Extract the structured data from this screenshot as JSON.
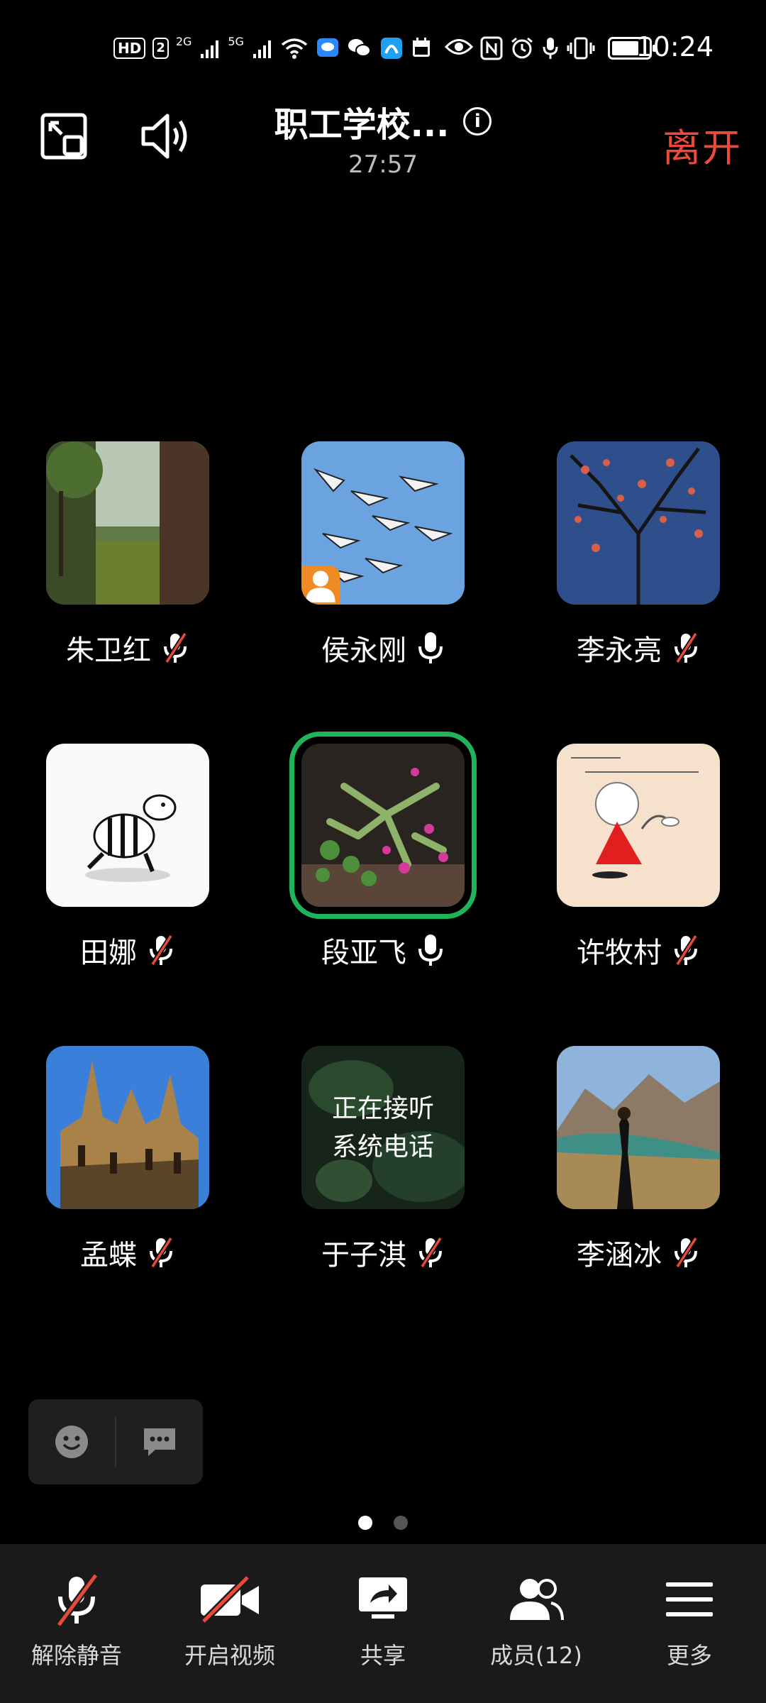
{
  "status_bar": {
    "hd_label": "HD",
    "sim_badge": "2",
    "net1": "2G",
    "net2": "5G",
    "time": "10:24",
    "battery_level": 0.75,
    "icons": [
      "hd-icon",
      "signal-icon",
      "signal-icon",
      "wifi-icon",
      "chat-app-icon",
      "wechat-icon",
      "app-icon",
      "calendar-icon",
      "eye-icon",
      "nfc-icon",
      "alarm-icon",
      "mic-icon",
      "vibrate-icon",
      "battery-icon"
    ]
  },
  "header": {
    "title": "职工学校...",
    "timer": "27:57",
    "leave_label": "离开"
  },
  "participants": [
    {
      "name": "朱卫红",
      "muted": true,
      "avatar": "forest-photo"
    },
    {
      "name": "侯永刚",
      "muted": false,
      "avatar": "cranes-sky",
      "host": true
    },
    {
      "name": "李永亮",
      "muted": true,
      "avatar": "tree-sky"
    },
    {
      "name": "田娜",
      "muted": true,
      "avatar": "zebra-cartoon"
    },
    {
      "name": "段亚飞",
      "muted": false,
      "avatar": "cactus-flower",
      "speaking": true
    },
    {
      "name": "许牧村",
      "muted": true,
      "avatar": "girl-drawing"
    },
    {
      "name": "孟蝶",
      "muted": true,
      "avatar": "cathedral"
    },
    {
      "name": "于子淇",
      "muted": true,
      "avatar": "dark-green",
      "status_line1": "正在接听",
      "status_line2": "系统电话"
    },
    {
      "name": "李涵冰",
      "muted": true,
      "avatar": "mountain-woman"
    }
  ],
  "pager": {
    "pages": 2,
    "current": 1
  },
  "bottom_bar": {
    "unmute": "解除静音",
    "video": "开启视频",
    "share": "共享",
    "members": "成员(12)",
    "more": "更多"
  },
  "colors": {
    "leave": "#ec4b3c",
    "speaking": "#1fb459",
    "host": "#f08a22",
    "muted_slash": "#e84a3a"
  }
}
